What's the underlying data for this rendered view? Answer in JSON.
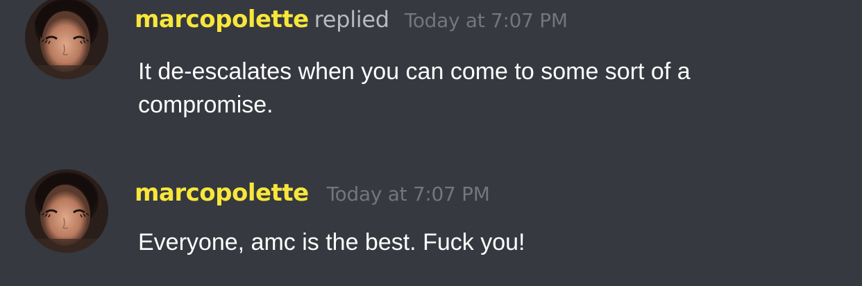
{
  "messages": [
    {
      "username": "marcopolette",
      "action": "replied",
      "timestamp": "Today at 7:07 PM",
      "content": "It de-escalates when you can come to some sort of a compromise.",
      "username_color": "#f8e63b"
    },
    {
      "username": "marcopolette",
      "timestamp": "Today at 7:07 PM",
      "content": "Everyone, amc is the best. Fuck you!",
      "username_color": "#f8e63b"
    }
  ],
  "colors": {
    "background": "#36393f",
    "message_text": "#ffffff",
    "timestamp": "#72767d",
    "action_text": "#b9bbbe"
  }
}
